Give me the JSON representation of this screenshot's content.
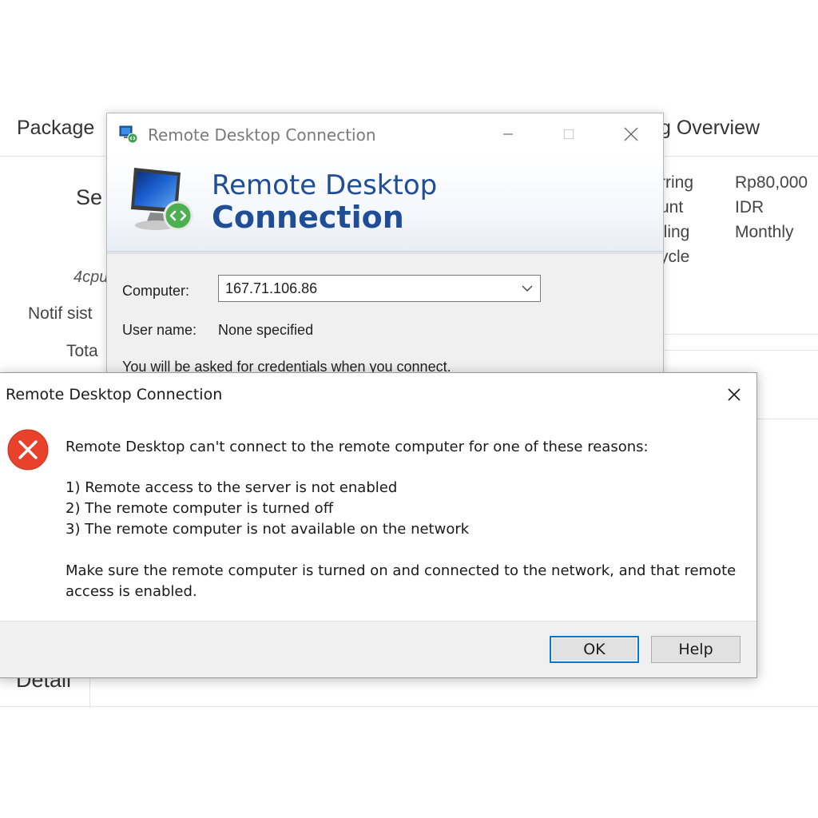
{
  "background_page": {
    "left_heading": "Package",
    "left_big": "Se",
    "left_italic": "4cpu",
    "left_notif": "Notif sist",
    "left_total": "Tota",
    "left_bottom": "Detail",
    "right_heading": "g Overview",
    "right_rows": [
      {
        "label": "rring",
        "value": "Rp80,000"
      },
      {
        "label": "unt",
        "value": "IDR"
      },
      {
        "label": "lling",
        "value": "Monthly"
      },
      {
        "label": "ycle",
        "value": ""
      }
    ]
  },
  "rdc_window": {
    "title": "Remote Desktop Connection",
    "banner_line1": "Remote Desktop",
    "banner_line2": "Connection",
    "computer_label": "Computer:",
    "computer_value": "167.71.106.86",
    "username_label": "User name:",
    "username_value": "None specified",
    "credentials_note": "You will be asked for credentials when you connect.",
    "icons": {
      "app": "remote-desktop-icon",
      "minimize": "minimize-icon",
      "maximize": "maximize-icon",
      "close": "close-icon",
      "monitor": "monitor-icon",
      "dropdown": "chevron-down-icon"
    }
  },
  "error_dialog": {
    "title": "Remote Desktop Connection",
    "message": "Remote Desktop can't connect to the remote computer for one of these reasons:",
    "reasons": [
      "1) Remote access to the server is not enabled",
      "2) The remote computer is turned off",
      "3) The remote computer is not available on the network"
    ],
    "advice_line1": "Make sure the remote computer is turned on and connected to the network, and that remote",
    "advice_line2": "access is enabled.",
    "ok_label": "OK",
    "help_label": "Help",
    "icons": {
      "error": "error-icon",
      "close": "close-icon"
    },
    "colors": {
      "error_red": "#e8412c",
      "focus_blue": "#0078d7"
    }
  },
  "colors": {
    "brand_blue": "#1f4d96"
  }
}
